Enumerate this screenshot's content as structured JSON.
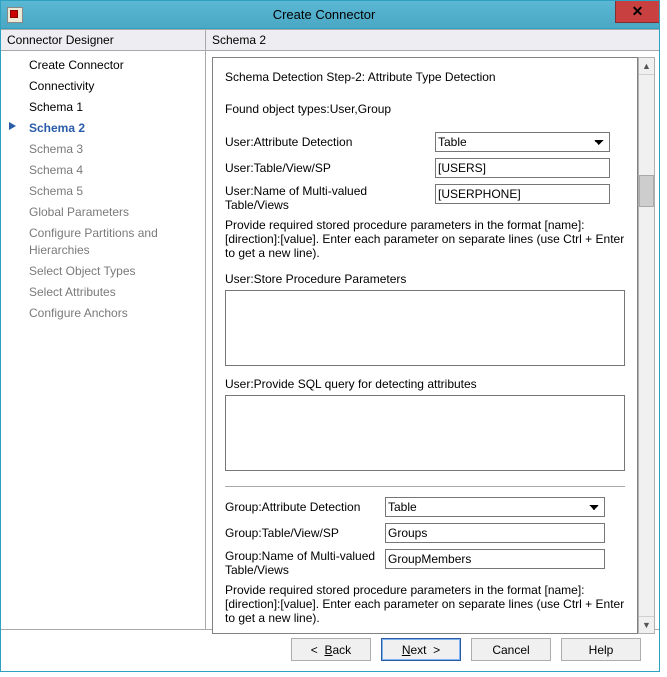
{
  "window": {
    "title": "Create Connector",
    "close_glyph": "✕"
  },
  "nav": {
    "header": "Connector Designer",
    "items": [
      {
        "label": "Create Connector",
        "state": "normal"
      },
      {
        "label": "Connectivity",
        "state": "normal"
      },
      {
        "label": "Schema 1",
        "state": "normal"
      },
      {
        "label": "Schema 2",
        "state": "current"
      },
      {
        "label": "Schema 3",
        "state": "muted"
      },
      {
        "label": "Schema 4",
        "state": "muted"
      },
      {
        "label": "Schema 5",
        "state": "muted"
      },
      {
        "label": "Global Parameters",
        "state": "muted"
      },
      {
        "label": "Configure Partitions and Hierarchies",
        "state": "muted"
      },
      {
        "label": "Select Object Types",
        "state": "muted"
      },
      {
        "label": "Select Attributes",
        "state": "muted"
      },
      {
        "label": "Configure Anchors",
        "state": "muted"
      }
    ]
  },
  "content": {
    "header": "Schema 2",
    "step_title": "Schema Detection Step-2: Attribute Type Detection",
    "found_types": "Found object types:User,Group",
    "user": {
      "attr_detection_label": "User:Attribute Detection",
      "attr_detection_value": "Table",
      "table_label": "User:Table/View/SP",
      "table_value": "[USERS]",
      "multivalued_label": "User:Name of Multi-valued Table/Views",
      "multivalued_value": "[USERPHONE]",
      "hint": "Provide required stored procedure parameters in the format [name]:[direction]:[value]. Enter each parameter on separate lines (use Ctrl + Enter to get a new line).",
      "sp_params_label": "User:Store Procedure Parameters",
      "sp_params_value": "",
      "sql_label": "User:Provide SQL query for detecting attributes",
      "sql_value": ""
    },
    "group": {
      "attr_detection_label": "Group:Attribute Detection",
      "attr_detection_value": "Table",
      "table_label": "Group:Table/View/SP",
      "table_value": "Groups",
      "multivalued_label": "Group:Name of Multi-valued Table/Views",
      "multivalued_value": "GroupMembers",
      "hint": "Provide required stored procedure parameters in the format [name]:[direction]:[value]. Enter each parameter on separate lines (use Ctrl + Enter to get a new line)."
    }
  },
  "footer": {
    "back": "Back",
    "next": "Next",
    "cancel": "Cancel",
    "help": "Help"
  }
}
